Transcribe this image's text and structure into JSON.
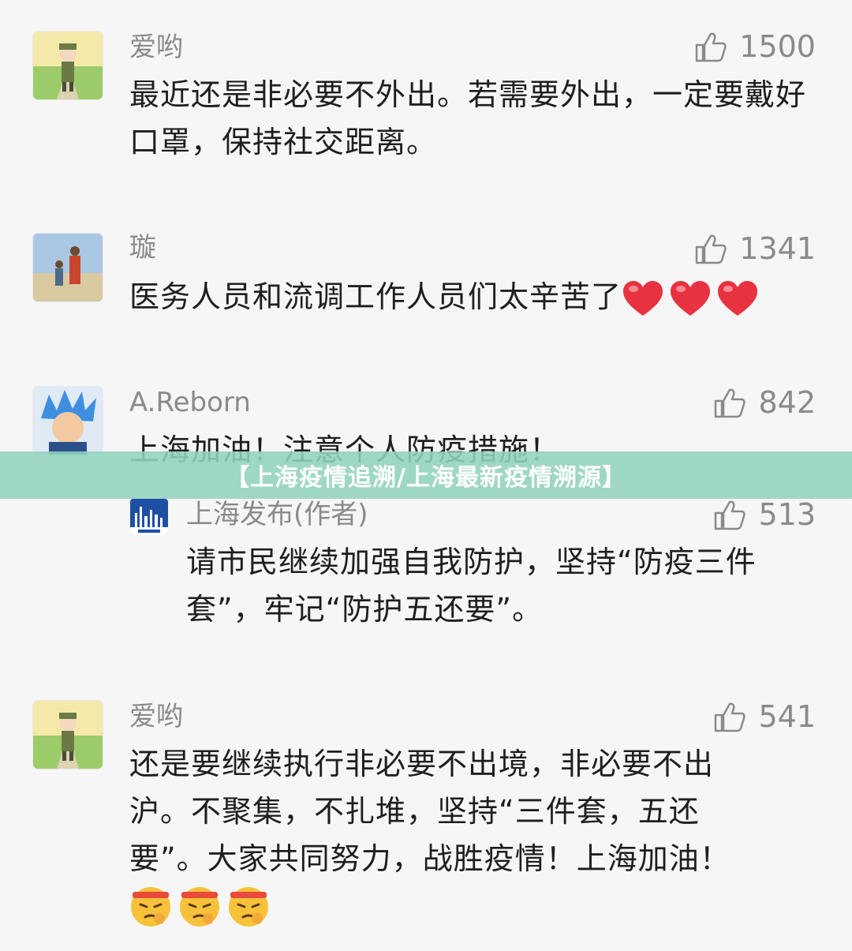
{
  "banner": {
    "title": "【上海疫情追溯/上海最新疫情溯源】"
  },
  "comments": [
    {
      "name": "爱哟",
      "likes": "1500",
      "text": "最近还是非必要不外出。若需要外出，一定要戴好口罩，保持社交距离。"
    },
    {
      "name": "璇",
      "likes": "1341",
      "text": "医务人员和流调工作人员们太辛苦了",
      "emoji": "red-heart"
    },
    {
      "name": "A.Reborn",
      "likes": "842",
      "text": "上海加油！注意个人防疫措施！"
    },
    {
      "name": "爱哟",
      "likes": "541",
      "text": "还是要继续执行非必要不出境，非必要不出沪。不聚集，不扎堆，坚持“三件套，五还要”。大家共同努力，战胜疫情！上海加油！",
      "emoji": "determined-face"
    }
  ],
  "reply": {
    "name": "上海发布(作者)",
    "likes": "513",
    "text": "请市民继续加强自我防护，坚持“防疫三件套”，牢记“防护五还要”。",
    "avatar_label": "上海发布"
  },
  "colors": {
    "banner_bg": "#93d3be",
    "meta_gray": "#8a8a8a",
    "heart_red": "#e8323f"
  }
}
